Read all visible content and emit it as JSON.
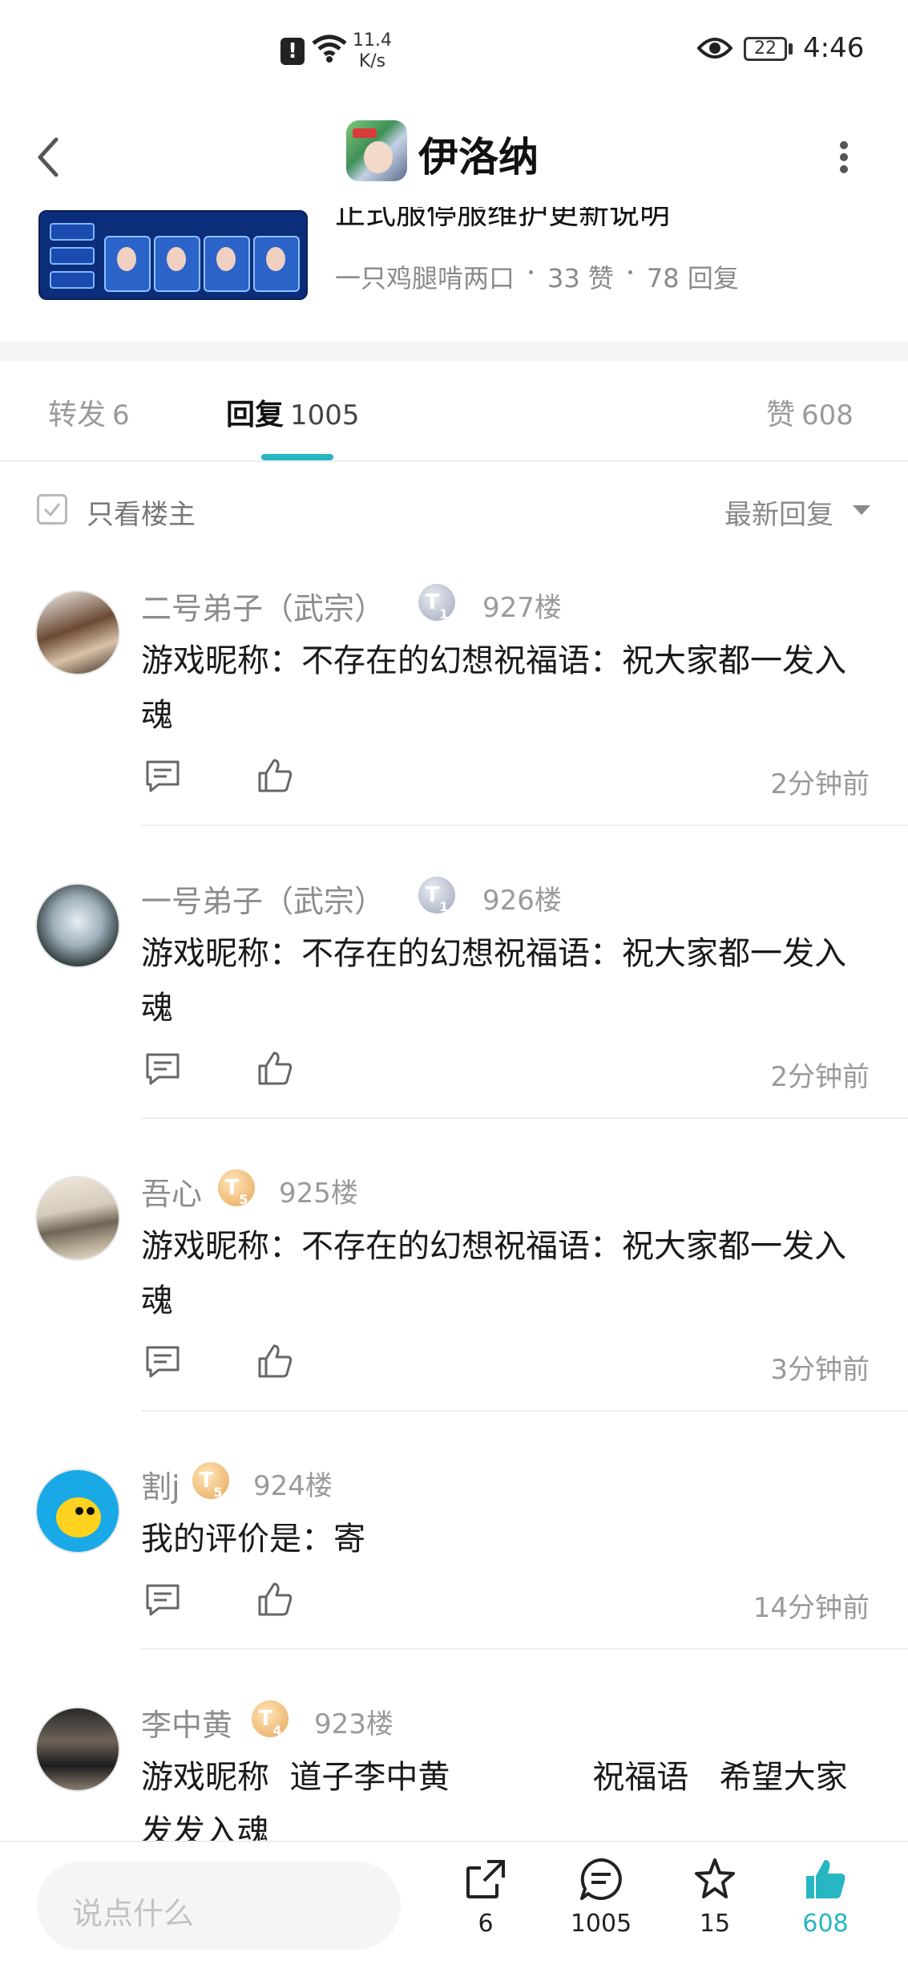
{
  "status_bar": {
    "net_speed_value": "11.4",
    "net_speed_unit": "K/s",
    "battery": "22",
    "time": "4:46"
  },
  "header": {
    "title": "伊洛纳"
  },
  "linked_post": {
    "title": "正式服停服维护更新说明",
    "author": "一只鸡腿啃两口",
    "likes": "33 赞",
    "replies": "78 回复"
  },
  "tabs": [
    {
      "label": "转发",
      "count": "6"
    },
    {
      "label": "回复",
      "count": "1005"
    },
    {
      "label": "赞",
      "count": "608"
    }
  ],
  "filter": {
    "only_owner": "只看楼主",
    "sort": "最新回复"
  },
  "comments": [
    {
      "name": "二号弟子（武宗）",
      "badge": "T",
      "badge_level": "1",
      "floor": "927楼",
      "text": "游戏昵称：不存在的幻想祝福语：祝大家都一发入魂",
      "time": "2分钟前"
    },
    {
      "name": "一号弟子（武宗）",
      "badge": "T",
      "badge_level": "1",
      "floor": "926楼",
      "text": "游戏昵称：不存在的幻想祝福语：祝大家都一发入魂",
      "time": "2分钟前"
    },
    {
      "name": "吾心",
      "badge": "T",
      "badge_level": "5",
      "floor": "925楼",
      "text": "游戏昵称：不存在的幻想祝福语：祝大家都一发入魂",
      "time": "3分钟前"
    },
    {
      "name": "割j",
      "badge": "T",
      "badge_level": "5",
      "floor": "924楼",
      "text": "我的评价是：寄",
      "time": "14分钟前"
    },
    {
      "name": "李中黄",
      "badge": "T",
      "badge_level": "4",
      "floor": "923楼",
      "text": "游戏昵称  道子李中黄              祝福语   希望大家发发入魂",
      "time": ""
    }
  ],
  "bottom_bar": {
    "input_placeholder": "说点什么",
    "share_count": "6",
    "comment_count": "1005",
    "favorite_count": "15",
    "like_count": "608",
    "accent_color": "#27b6c2"
  }
}
